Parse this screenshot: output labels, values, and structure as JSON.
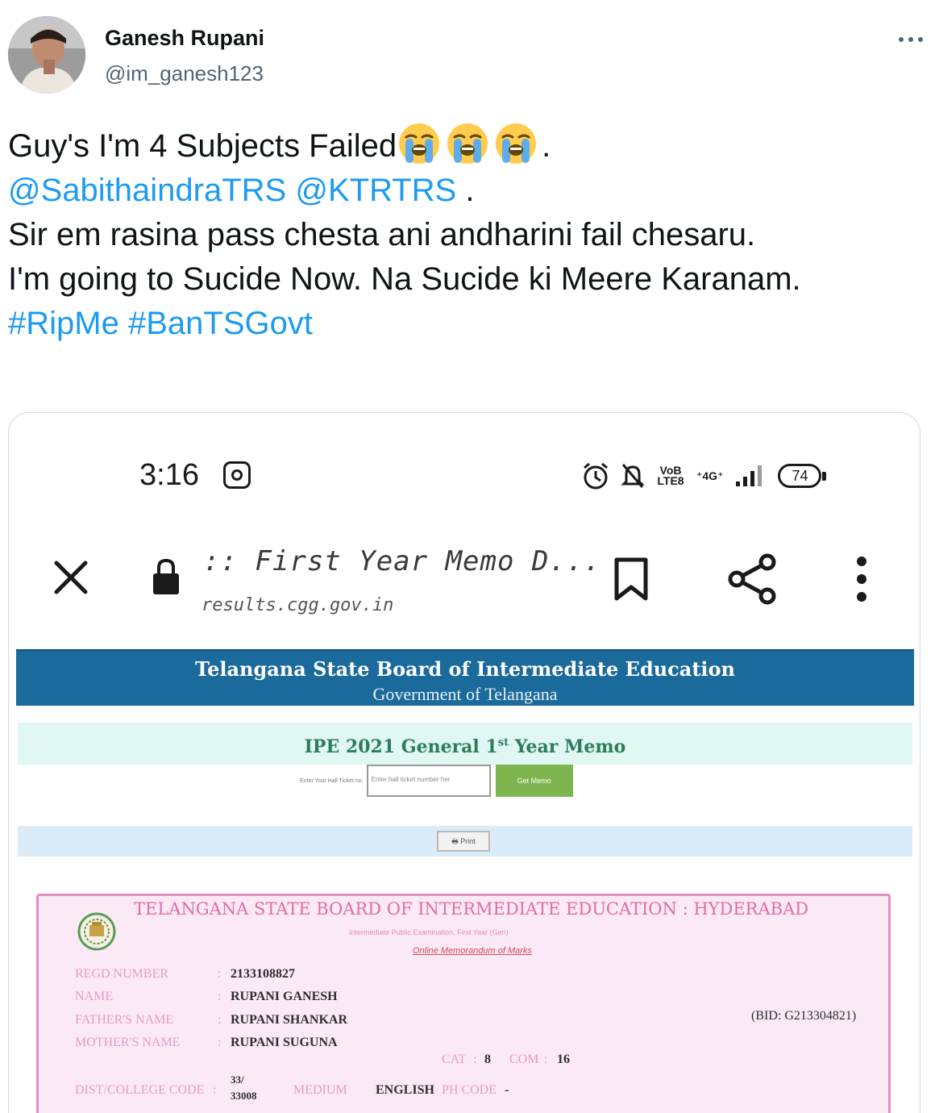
{
  "tweet": {
    "author_name": "Ganesh Rupani",
    "author_handle": "@im_ganesh123",
    "line1_text": "Guy's I'm 4 Subjects Failed",
    "line1_emoji_count": 3,
    "line1_end": ".",
    "mention1": "@SabithaindraTRS",
    "mention2": "@KTRTRS",
    "line2_end": " .",
    "line3": "Sir em rasina pass chesta ani andharini fail chesaru.",
    "line4": "I'm going to Sucide Now. Na Sucide ki Meere Karanam.",
    "hashtag1": "#RipMe",
    "hashtag2": "#BanTSGovt"
  },
  "phone": {
    "time": "3:16",
    "volte": "VoB LTE8",
    "network": "⁺4G⁺",
    "battery": "74"
  },
  "browser": {
    "page_title": ":: First Year Memo D...",
    "url": "results.cgg.gov.in"
  },
  "site": {
    "header_title": "Telangana State Board of Intermediate Education",
    "header_subtitle": "Government of Telangana",
    "memo_title_pre": "IPE 2021 General 1",
    "memo_title_sup": "st",
    "memo_title_post": " Year Memo",
    "hall_label": "Enter Your Hall Ticket no.",
    "hall_placeholder": "Enter hall ticket number her",
    "get_memo_button": "Get Memo",
    "print_button": "Print"
  },
  "memo": {
    "title": "TELANGANA STATE BOARD OF INTERMEDIATE EDUCATION : HYDERABAD",
    "subtitle": "Intermediate Public Examination, First Year (Gen)",
    "online_label": "Online Memorandum of Marks",
    "fields": {
      "regd_label": "REGD NUMBER",
      "regd_value": "2133108827",
      "name_label": "NAME",
      "name_value": "RUPANI GANESH",
      "father_label": "FATHER'S NAME",
      "father_value": "RUPANI SHANKAR",
      "mother_label": "MOTHER'S NAME",
      "mother_value": "RUPANI SUGUNA",
      "cat_label": "CAT",
      "cat_value": "8",
      "com_label": "COM",
      "com_value": "16",
      "dist_label": "DIST/COLLEGE CODE",
      "dist_value_1": "33/",
      "dist_value_2": "33008",
      "medium_label": "MEDIUM",
      "medium_value": "ENGLISH",
      "ph_label": "PH CODE",
      "ph_value": "-"
    },
    "bid": "(BID: G213304821)"
  }
}
